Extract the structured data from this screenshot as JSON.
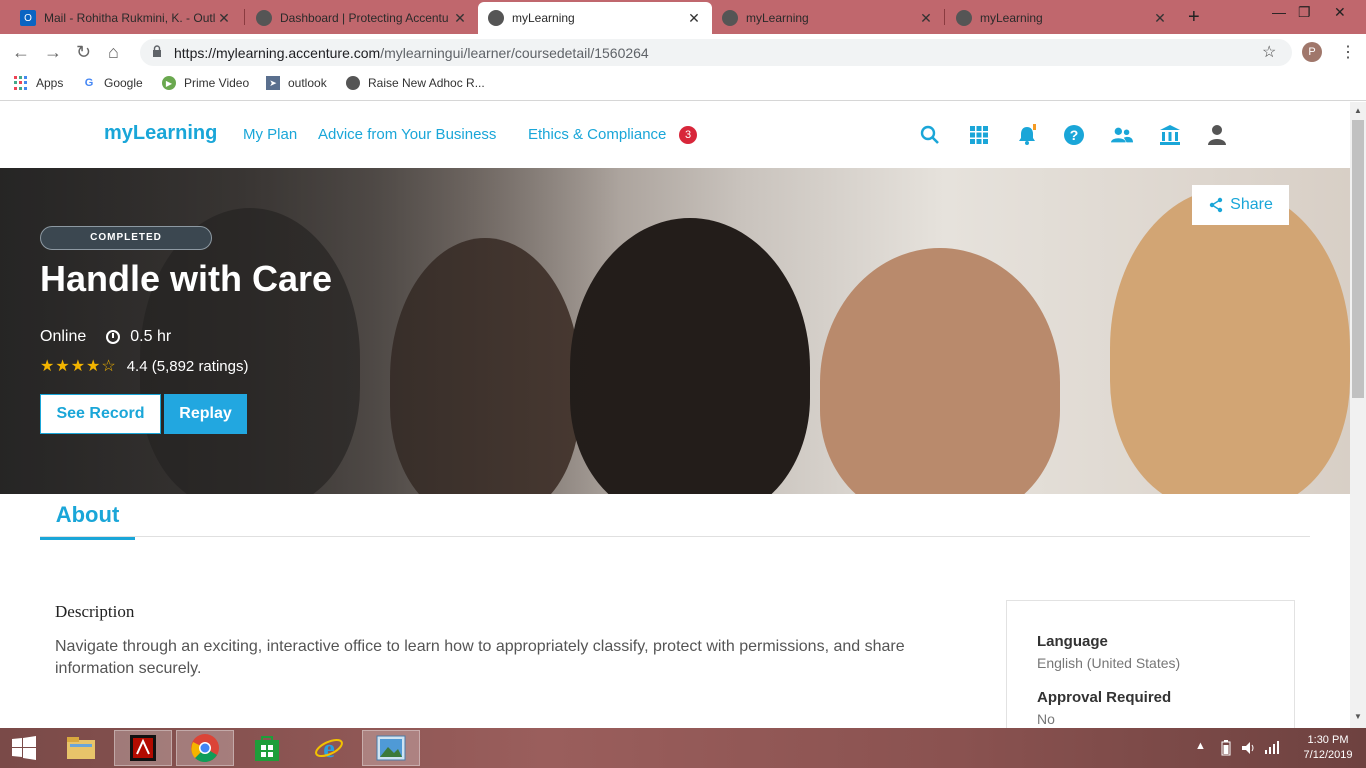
{
  "browser": {
    "tabs": [
      {
        "label": "Mail - Rohitha Rukmini, K. - Outl",
        "icon": "outlook-icon"
      },
      {
        "label": "Dashboard | Protecting Accentu",
        "icon": "globe-icon"
      },
      {
        "label": "myLearning",
        "icon": "globe-icon",
        "active": true
      },
      {
        "label": "myLearning",
        "icon": "globe-icon"
      },
      {
        "label": "myLearning",
        "icon": "globe-icon"
      }
    ],
    "close_glyph": "✕",
    "new_tab_glyph": "+",
    "url_host": "https://mylearning.accenture.com",
    "url_path": "/mylearningui/learner/coursedetail/1560264",
    "profile_initial": "P",
    "bookmarks": [
      "Apps",
      "Google",
      "Prime Video",
      "outlook",
      "Raise New Adhoc R..."
    ]
  },
  "site": {
    "brand": "myLearning",
    "nav": [
      "My Plan",
      "Advice from Your Business",
      "Ethics & Compliance"
    ],
    "compliance_badge": "3",
    "header_icons": [
      "search-icon",
      "apps-grid-icon",
      "notifications-bell-icon",
      "help-icon",
      "people-icon",
      "institution-icon",
      "profile-icon"
    ],
    "accent_color": "#1aa6d8"
  },
  "course": {
    "status": "COMPLETED",
    "title": "Handle with Care",
    "format": "Online",
    "duration": "0.5 hr",
    "rating_value": 4.4,
    "rating_text": "4.4 (5,892 ratings)",
    "see_record_label": "See Record",
    "replay_label": "Replay",
    "share_label": "Share"
  },
  "about": {
    "tab_label": "About",
    "description_heading": "Description",
    "description": "Navigate through an exciting, interactive office to learn how to appropriately classify, protect with permissions, and share information securely.",
    "details": [
      {
        "label": "Language",
        "value": "English (United States)"
      },
      {
        "label": "Approval Required",
        "value": "No"
      }
    ]
  },
  "taskbar": {
    "apps": [
      "file-explorer-icon",
      "acrobat-icon",
      "chrome-icon",
      "store-icon",
      "internet-explorer-icon",
      "photo-viewer-icon"
    ],
    "time": "1:30 PM",
    "date": "7/12/2019"
  }
}
